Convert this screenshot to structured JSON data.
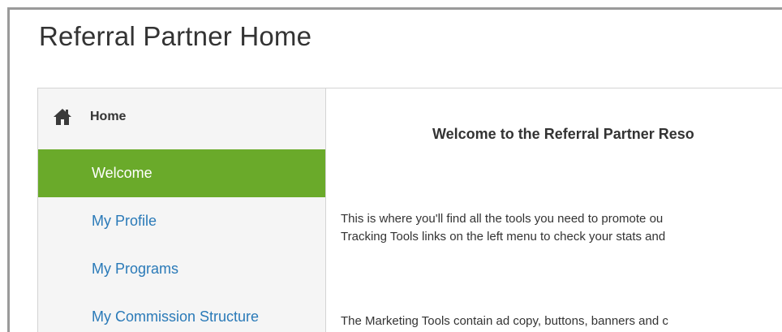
{
  "page": {
    "title": "Referral Partner Home"
  },
  "sidebar": {
    "header": {
      "icon": "home-icon",
      "label": "Home"
    },
    "items": [
      {
        "label": "Welcome",
        "active": true
      },
      {
        "label": "My Profile",
        "active": false
      },
      {
        "label": "My Programs",
        "active": false
      },
      {
        "label": "My Commission Structure",
        "active": false
      }
    ]
  },
  "content": {
    "heading": "Welcome to the Referral Partner Reso",
    "paragraphs": [
      {
        "line1": "This is where you'll find all the tools you need to promote ou",
        "line2": "Tracking Tools links on the left menu to check your stats and"
      },
      {
        "line1": "The Marketing Tools contain ad copy, buttons, banners and c"
      }
    ]
  },
  "colors": {
    "accent": "#6aaa2a",
    "link": "#2a7ab8",
    "text": "#333333",
    "sidebar_bg": "#f5f5f5"
  }
}
